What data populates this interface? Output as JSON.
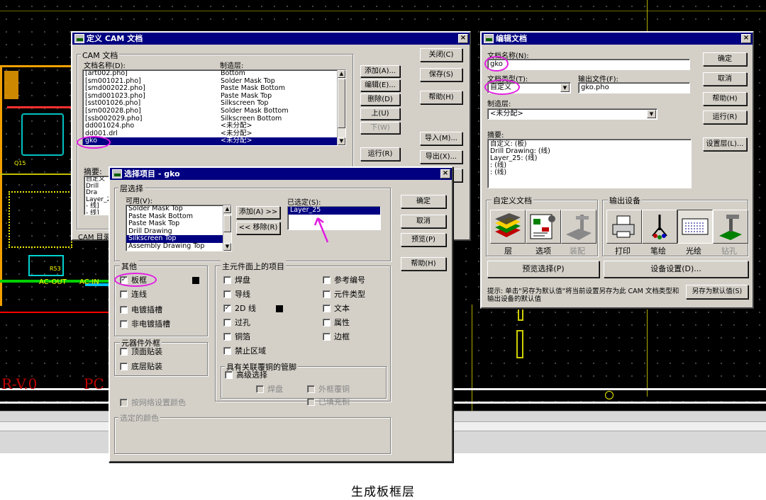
{
  "background": {
    "pcb_text_left": "R-V.0",
    "pcb_text_mid": "PC",
    "pcb_label_1": "AC-OUT",
    "pcb_label_2": "AC-IN",
    "pcb_label_3": "R53",
    "pcb_label_4": "Q15"
  },
  "caption": "生成板框层",
  "cam_dialog": {
    "title": "定义 CAM 文档",
    "group_label": "CAM 文档",
    "col_name": "文档名称(D):",
    "col_layer": "制造层:",
    "files": [
      {
        "name": "[art002.pho]",
        "layer": "Bottom"
      },
      {
        "name": "[sm001021.pho]",
        "layer": "Solder Mask Top"
      },
      {
        "name": "[smd002022.pho]",
        "layer": "Paste Mask Bottom"
      },
      {
        "name": "[smd001023.pho]",
        "layer": "Paste Mask Top"
      },
      {
        "name": "[sst001026.pho]",
        "layer": "Silkscreen Top"
      },
      {
        "name": "[sm002028.pho]",
        "layer": "Solder Mask Bottom"
      },
      {
        "name": "[ssb002029.pho]",
        "layer": "Silkscreen Bottom"
      },
      {
        "name": "dd001024.pho",
        "layer": "<未分配>"
      },
      {
        "name": "dd001.drl",
        "layer": "<未分配>"
      },
      {
        "name": "gko",
        "layer": "<未分配>"
      }
    ],
    "summary_label": "摘要:",
    "summary_lines": [
      "自定义",
      "Drill Dra",
      "Layer_2",
      "- 线]",
      "- 线]"
    ],
    "cam_dir_label": "CAM 目录",
    "buttons": {
      "add": "添加(A)...",
      "edit": "编辑(E)...",
      "delete": "删除(D)",
      "up": "上(U)",
      "down": "下(W)",
      "run": "运行(R)",
      "close": "关闭(C)",
      "save": "保存(S)",
      "help": "帮助(H)",
      "import": "导入(M)...",
      "export": "导出(X)..."
    }
  },
  "edit_dialog": {
    "title": "编辑文档",
    "doc_name_label": "文档名称(N):",
    "doc_name_value": "gko",
    "doc_type_label": "文档类型(T):",
    "doc_type_value": "自定义",
    "out_file_label": "输出文件(F):",
    "out_file_value": "gko.pho",
    "mfg_layer_label": "制造层:",
    "mfg_layer_value": "<未分配>",
    "summary_label": "摘要:",
    "summary_lines": [
      "自定义: (板)",
      "Drill Drawing: (线)",
      "Layer_25: (线)",
      ": (线)",
      ": (线)"
    ],
    "custom_group": "自定义文档",
    "output_group": "输出设备",
    "icons": {
      "layer": "层",
      "options": "选项",
      "assembly": "装配",
      "print": "打印",
      "pen": "笔绘",
      "photo": "光绘",
      "drill": "钻孔"
    },
    "preview_btn": "预览选择(P)",
    "device_btn": "设备设置(D)...",
    "hint": "提示: 单击\"另存为默认值\"将当前设置另存为此 CAM 文档类型和输出设备的默认值",
    "save_default_btn": "另存为默认值(S)",
    "buttons": {
      "ok": "确定",
      "cancel": "取消",
      "help": "帮助(H)",
      "run": "运行(R)",
      "layer_setup": "设置层(L)..."
    }
  },
  "select_dialog": {
    "title": "选择项目 - gko",
    "layer_group": "层选择",
    "available_label": "可用(V):",
    "available": [
      "Solder Mask Top",
      "Paste Mask Bottom",
      "Paste Mask Top",
      "Drill Drawing",
      "Silkscreen Top",
      "Assembly Drawing Top"
    ],
    "add_btn": "添加(A) >>",
    "remove_btn": "<< 移除(R)",
    "selected_label": "已选定(S):",
    "selected": [
      "Layer_25"
    ],
    "other_group": "其他",
    "other": [
      "板框",
      "连线",
      "电镀插槽",
      "非电镀插槽"
    ],
    "outline_group": "元器件外框",
    "outline": [
      "顶面贴装",
      "底层贴装"
    ],
    "net_color": "按网络设置颜色",
    "sel_color_group": "选定的颜色",
    "primary_group": "主元件面上的项目",
    "primary_col1": [
      "焊盘",
      "导线",
      "2D 线",
      "过孔",
      "铜箔",
      "禁止区域"
    ],
    "primary_col2": [
      "参考编号",
      "元件类型",
      "文本",
      "属性",
      "边框"
    ],
    "assoc_group": "具有关联覆铜的管脚",
    "advanced": "高级选择",
    "pad": "焊盘",
    "outline_copper": "外框覆铜",
    "filled_copper": "已填充铜",
    "buttons": {
      "ok": "确定",
      "cancel": "取消",
      "preview": "预览(P)",
      "help": "帮助(H)"
    }
  }
}
